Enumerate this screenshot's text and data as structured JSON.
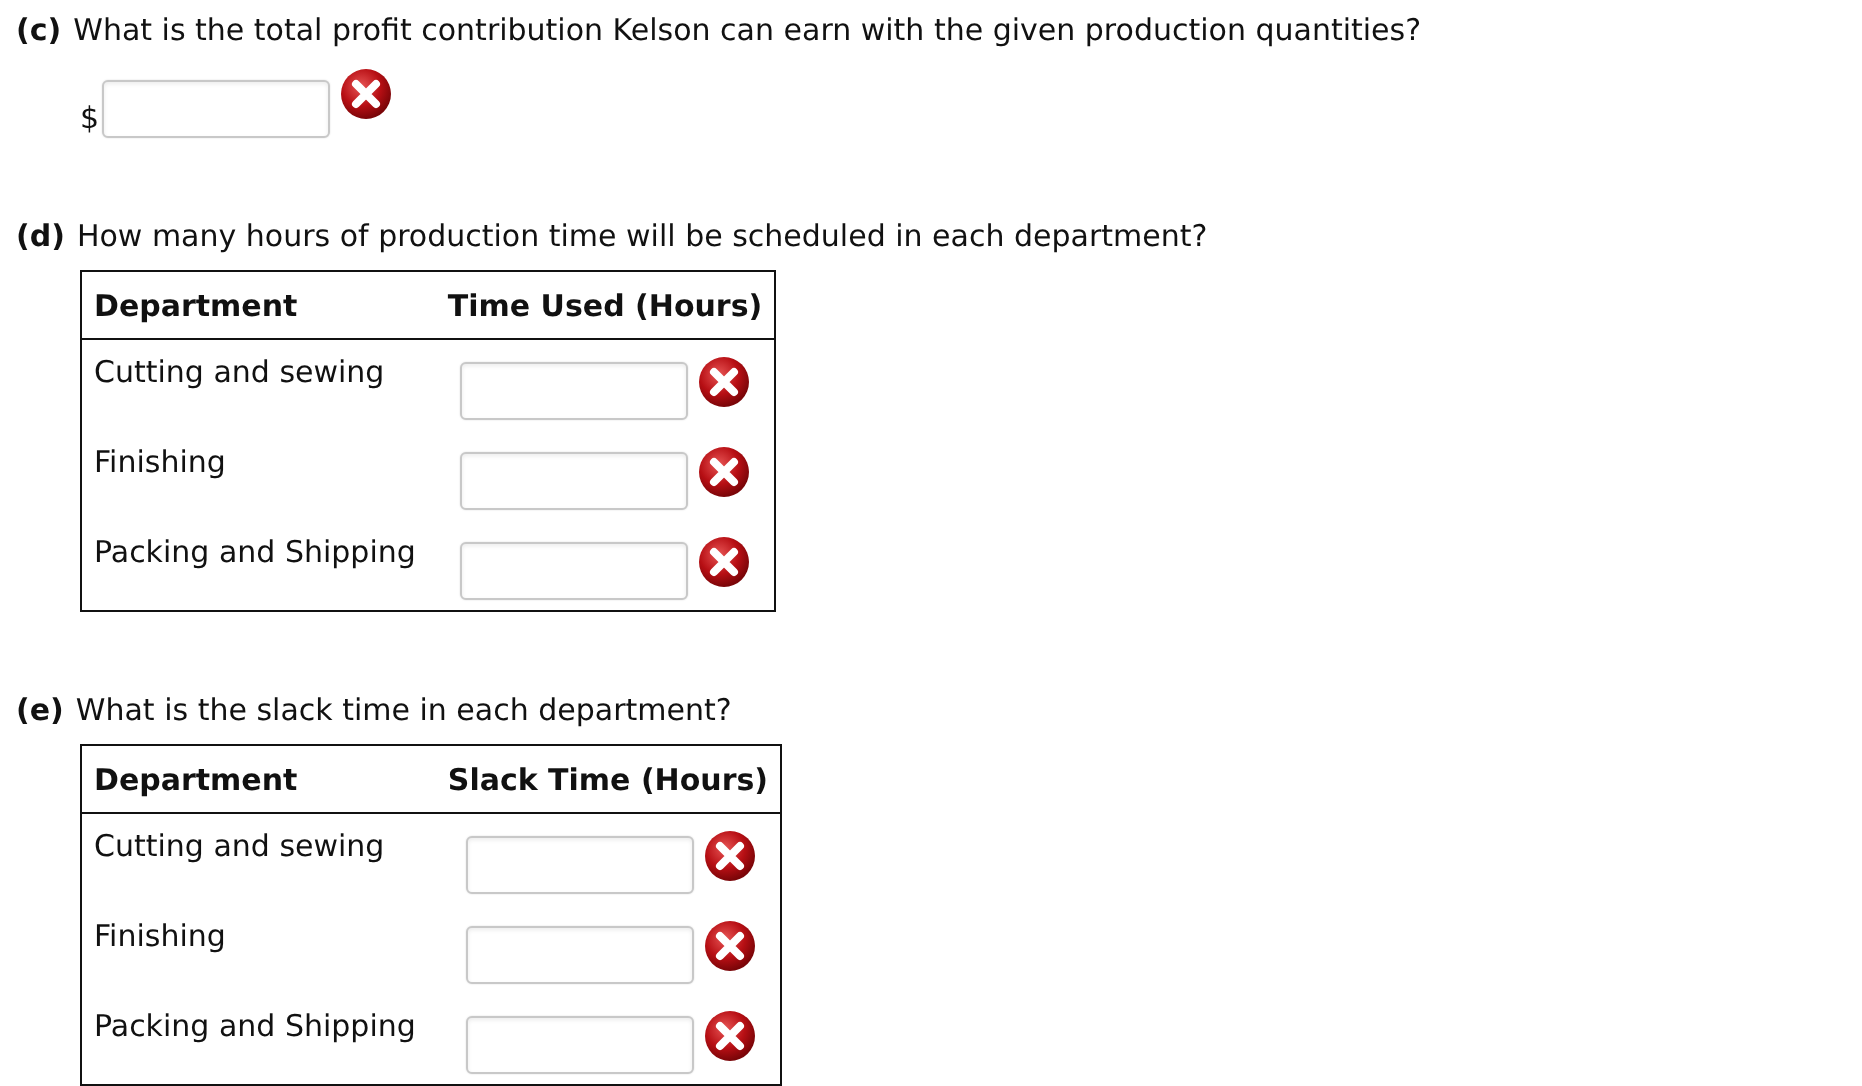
{
  "parts": [
    {
      "label": "(c)",
      "question": "What is the total profit contribution Kelson can earn with the given production quantities?",
      "kind": "single",
      "prefix": "$",
      "answer": {
        "incorrect": true
      }
    },
    {
      "label": "(d)",
      "question": "How many hours of production time will be scheduled in each department?",
      "kind": "table",
      "columns": [
        "Department",
        "Time Used (Hours)"
      ],
      "rows": [
        {
          "department": "Cutting and sewing",
          "answer": {
            "incorrect": true
          }
        },
        {
          "department": "Finishing",
          "answer": {
            "incorrect": true
          }
        },
        {
          "department": "Packing and Shipping",
          "answer": {
            "incorrect": true
          }
        }
      ]
    },
    {
      "label": "(e)",
      "question": "What is the slack time in each department?",
      "kind": "table",
      "columns": [
        "Department",
        "Slack Time (Hours)"
      ],
      "rows": [
        {
          "department": "Cutting and sewing",
          "answer": {
            "incorrect": true
          }
        },
        {
          "department": "Finishing",
          "answer": {
            "incorrect": true
          }
        },
        {
          "department": "Packing and Shipping",
          "answer": {
            "incorrect": true
          }
        }
      ]
    }
  ]
}
